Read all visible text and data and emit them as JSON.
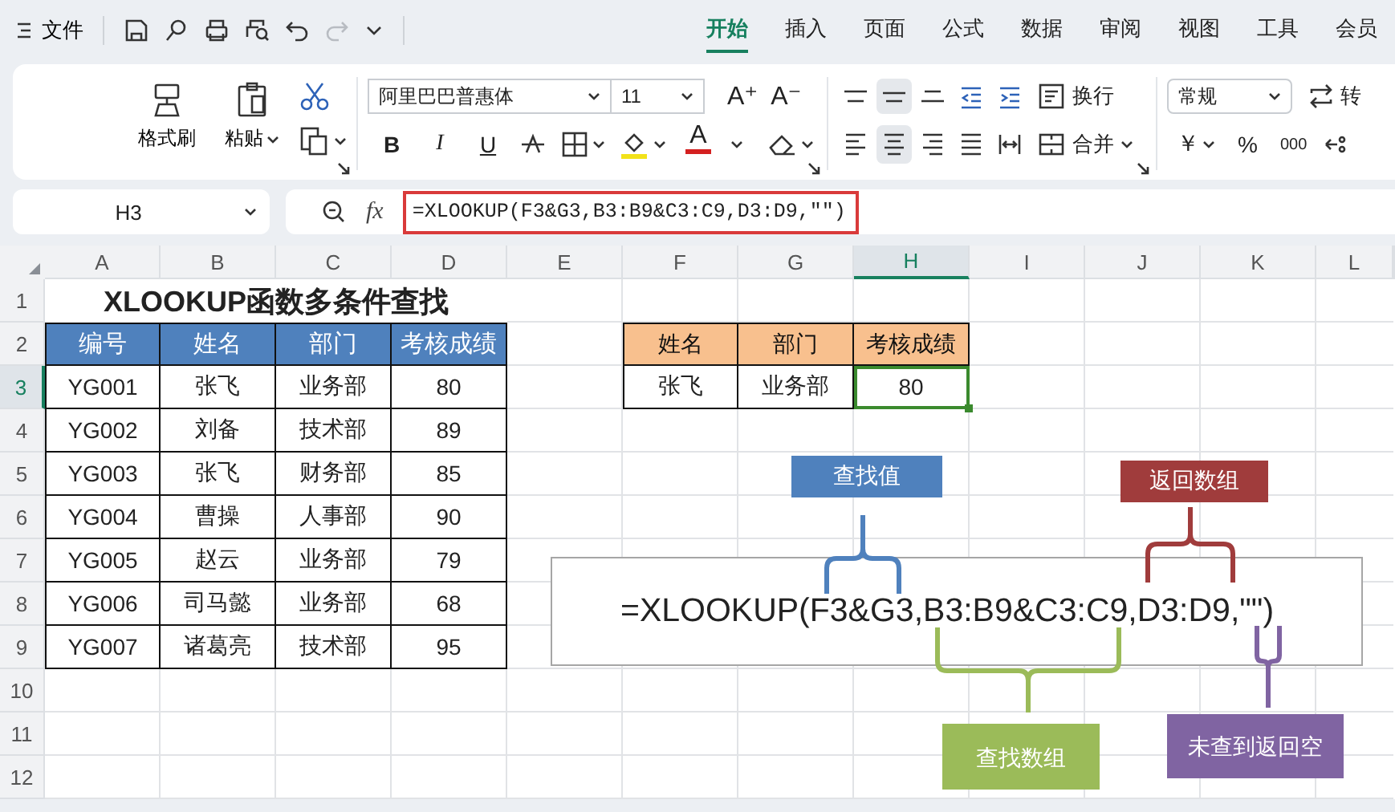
{
  "top_bar": {
    "file_menu": "文件"
  },
  "tabs": [
    {
      "label": "开始",
      "selected": true
    },
    {
      "label": "插入",
      "selected": false
    },
    {
      "label": "页面",
      "selected": false
    },
    {
      "label": "公式",
      "selected": false
    },
    {
      "label": "数据",
      "selected": false
    },
    {
      "label": "审阅",
      "selected": false
    },
    {
      "label": "视图",
      "selected": false
    },
    {
      "label": "工具",
      "selected": false
    },
    {
      "label": "会员",
      "selected": false
    }
  ],
  "ribbon": {
    "format_painter": "格式刷",
    "paste": "粘贴",
    "font_name": "阿里巴巴普惠体",
    "font_size": "11",
    "grow_font": "A⁺",
    "shrink_font": "A⁻",
    "styles": [
      {
        "label": "B",
        "kind": "bold"
      },
      {
        "label": "I",
        "kind": "italic"
      },
      {
        "label": "U",
        "kind": "underline"
      }
    ],
    "font_color": "A",
    "wrap_text": "换行",
    "merge": "合并",
    "vertical_align": [
      {
        "kind": "top",
        "selected": false
      },
      {
        "kind": "middle",
        "selected": true
      },
      {
        "kind": "bottom",
        "selected": false
      }
    ],
    "horizontal_align": [
      {
        "kind": "left",
        "selected": false
      },
      {
        "kind": "center",
        "selected": true
      },
      {
        "kind": "right",
        "selected": false
      },
      {
        "kind": "justify",
        "selected": false
      }
    ],
    "number_format": "常规",
    "convert": "转",
    "currency": "￥",
    "percent": "%",
    "thousands": "000"
  },
  "formula_bar": {
    "cell_ref": "H3",
    "fx": "fx",
    "formula": "=XLOOKUP(F3&G3,B3:B9&C3:C9,D3:D9,\"\")"
  },
  "sheet": {
    "columns": [
      {
        "label": "A",
        "selected": false
      },
      {
        "label": "B",
        "selected": false
      },
      {
        "label": "C",
        "selected": false
      },
      {
        "label": "D",
        "selected": false
      },
      {
        "label": "E",
        "selected": false
      },
      {
        "label": "F",
        "selected": false
      },
      {
        "label": "G",
        "selected": false
      },
      {
        "label": "H",
        "selected": true
      },
      {
        "label": "I",
        "selected": false
      },
      {
        "label": "J",
        "selected": false
      },
      {
        "label": "K",
        "selected": false
      },
      {
        "label": "L",
        "selected": false
      }
    ],
    "rows": [
      {
        "label": "1",
        "selected": false
      },
      {
        "label": "2",
        "selected": false
      },
      {
        "label": "3",
        "selected": true
      },
      {
        "label": "4",
        "selected": false
      },
      {
        "label": "5",
        "selected": false
      },
      {
        "label": "6",
        "selected": false
      },
      {
        "label": "7",
        "selected": false
      },
      {
        "label": "8",
        "selected": false
      },
      {
        "label": "9",
        "selected": false
      },
      {
        "label": "10",
        "selected": false
      },
      {
        "label": "11",
        "selected": false
      },
      {
        "label": "12",
        "selected": false
      }
    ],
    "title": "XLOOKUP函数多条件查找",
    "source_table": {
      "headers": [
        "编号",
        "姓名",
        "部门",
        "考核成绩"
      ],
      "rows": [
        [
          "YG001",
          "张飞",
          "业务部",
          "80"
        ],
        [
          "YG002",
          "刘备",
          "技术部",
          "89"
        ],
        [
          "YG003",
          "张飞",
          "财务部",
          "85"
        ],
        [
          "YG004",
          "曹操",
          "人事部",
          "90"
        ],
        [
          "YG005",
          "赵云",
          "业务部",
          "79"
        ],
        [
          "YG006",
          "司马懿",
          "业务部",
          "68"
        ],
        [
          "YG007",
          "诸葛亮",
          "技术部",
          "95"
        ]
      ]
    },
    "lookup_table": {
      "headers": [
        "姓名",
        "部门",
        "考核成绩"
      ],
      "values": [
        {
          "text": "张飞",
          "selected": false
        },
        {
          "text": "业务部",
          "selected": false
        },
        {
          "text": "80",
          "selected": true
        }
      ]
    }
  },
  "diagram": {
    "formula": "=XLOOKUP(F3&G3,B3:B9&C3:C9,D3:D9,\"\")",
    "callouts": [
      {
        "label": "查找值",
        "color": "#4f81bd",
        "kind": "above"
      },
      {
        "label": "返回数组",
        "color": "#a03c3c",
        "kind": "above"
      },
      {
        "label": "查找数组",
        "color": "#9bbb59",
        "kind": "below"
      },
      {
        "label": "未查到返回空",
        "color": "#8064a2",
        "kind": "below"
      }
    ]
  }
}
